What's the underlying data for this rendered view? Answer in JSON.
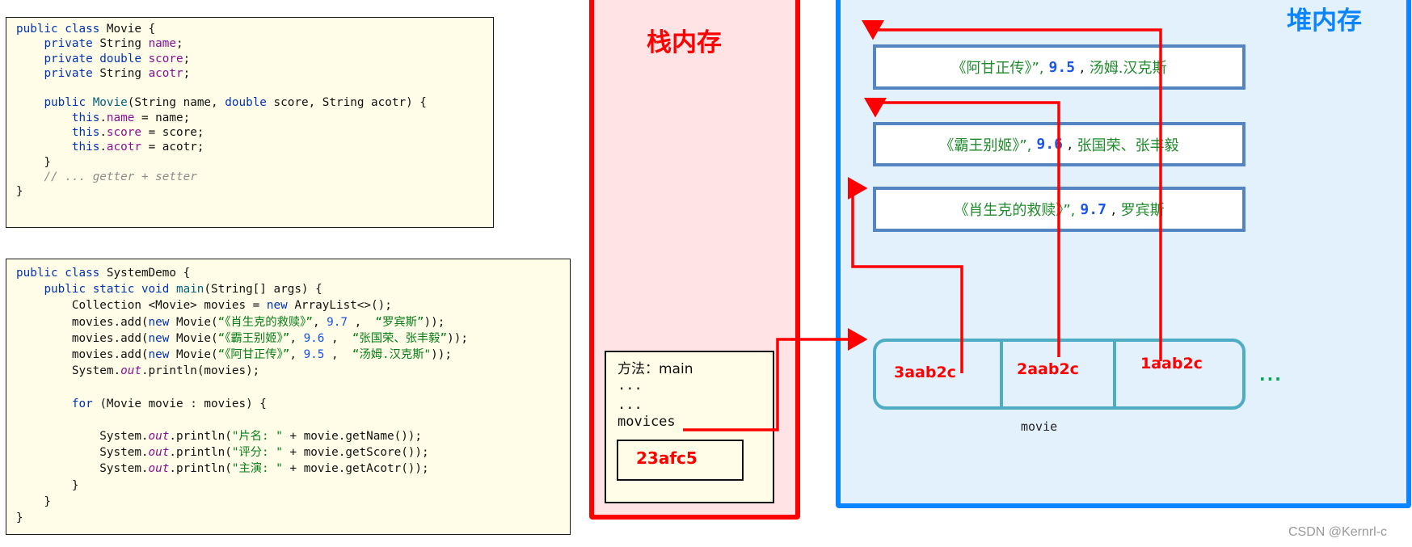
{
  "code_movie": {
    "lines": [
      [
        [
          "kw",
          "public class "
        ],
        [
          "",
          "Movie {"
        ]
      ],
      [
        [
          "",
          "    "
        ],
        [
          "kw",
          "private "
        ],
        [
          "",
          "String "
        ],
        [
          "fld",
          "name"
        ],
        [
          "",
          ";"
        ]
      ],
      [
        [
          "",
          "    "
        ],
        [
          "kw",
          "private double "
        ],
        [
          "fld",
          "score"
        ],
        [
          "",
          ";"
        ]
      ],
      [
        [
          "",
          "    "
        ],
        [
          "kw",
          "private "
        ],
        [
          "",
          "String "
        ],
        [
          "fld",
          "acotr"
        ],
        [
          "",
          ";"
        ]
      ],
      [
        [
          "",
          ""
        ]
      ],
      [
        [
          "",
          "    "
        ],
        [
          "kw",
          "public "
        ],
        [
          "fn",
          "Movie"
        ],
        [
          "",
          "(String name, "
        ],
        [
          "kw",
          "double "
        ],
        [
          "",
          "score, String acotr) {"
        ]
      ],
      [
        [
          "",
          "        "
        ],
        [
          "kw",
          "this"
        ],
        [
          "",
          "."
        ],
        [
          "fld",
          "name"
        ],
        [
          "",
          " = name;"
        ]
      ],
      [
        [
          "",
          "        "
        ],
        [
          "kw",
          "this"
        ],
        [
          "",
          "."
        ],
        [
          "fld",
          "score"
        ],
        [
          "",
          " = score;"
        ]
      ],
      [
        [
          "",
          "        "
        ],
        [
          "kw",
          "this"
        ],
        [
          "",
          "."
        ],
        [
          "fld",
          "acotr"
        ],
        [
          "",
          " = acotr;"
        ]
      ],
      [
        [
          "",
          "    }"
        ]
      ],
      [
        [
          "",
          "    "
        ],
        [
          "cmt",
          "// ... getter + setter"
        ]
      ],
      [
        [
          "",
          "}"
        ]
      ]
    ]
  },
  "code_demo": {
    "lines": [
      [
        [
          "kw",
          "public class "
        ],
        [
          "",
          "SystemDemo {"
        ]
      ],
      [
        [
          "",
          "    "
        ],
        [
          "kw",
          "public static void "
        ],
        [
          "fn",
          "main"
        ],
        [
          "",
          "(String[] args) {"
        ]
      ],
      [
        [
          "",
          "        Collection <Movie> movies = "
        ],
        [
          "kw",
          "new "
        ],
        [
          "",
          "ArrayList<>();"
        ]
      ],
      [
        [
          "",
          "        movies.add("
        ],
        [
          "kw",
          "new "
        ],
        [
          "",
          "Movie("
        ],
        [
          "str",
          "“《肖生克的救赎》”"
        ],
        [
          "",
          ", "
        ],
        [
          "num",
          "9.7"
        ],
        [
          "",
          " ,  "
        ],
        [
          "str",
          "“罗宾斯”"
        ],
        [
          "",
          "));"
        ]
      ],
      [
        [
          "",
          "        movies.add("
        ],
        [
          "kw",
          "new "
        ],
        [
          "",
          "Movie("
        ],
        [
          "str",
          "“《霸王别姬》”"
        ],
        [
          "",
          ", "
        ],
        [
          "num",
          "9.6"
        ],
        [
          "",
          " ,  "
        ],
        [
          "str",
          "“张国荣、张丰毅”"
        ],
        [
          "",
          "));"
        ]
      ],
      [
        [
          "",
          "        movies.add("
        ],
        [
          "kw",
          "new "
        ],
        [
          "",
          "Movie("
        ],
        [
          "str",
          "“《阿甘正传》”"
        ],
        [
          "",
          ", "
        ],
        [
          "num",
          "9.5"
        ],
        [
          "",
          " ,  "
        ],
        [
          "str",
          "“汤姆.汉克斯\""
        ],
        [
          "",
          "));"
        ]
      ],
      [
        [
          "",
          "        System."
        ],
        [
          "st",
          "out"
        ],
        [
          "",
          ".println(movies);"
        ]
      ],
      [
        [
          "",
          ""
        ]
      ],
      [
        [
          "",
          "        "
        ],
        [
          "kw",
          "for "
        ],
        [
          "",
          "(Movie movie : movies) {"
        ]
      ],
      [
        [
          "",
          ""
        ]
      ],
      [
        [
          "",
          "            System."
        ],
        [
          "st",
          "out"
        ],
        [
          "",
          ".println("
        ],
        [
          "str",
          "\"片名: \""
        ],
        [
          "",
          " + movie.getName());"
        ]
      ],
      [
        [
          "",
          "            System."
        ],
        [
          "st",
          "out"
        ],
        [
          "",
          ".println("
        ],
        [
          "str",
          "\"评分: \""
        ],
        [
          "",
          " + movie.getScore());"
        ]
      ],
      [
        [
          "",
          "            System."
        ],
        [
          "st",
          "out"
        ],
        [
          "",
          ".println("
        ],
        [
          "str",
          "\"主演: \""
        ],
        [
          "",
          " + movie.getAcotr());"
        ]
      ],
      [
        [
          "",
          "        }"
        ]
      ],
      [
        [
          "",
          "    }"
        ]
      ],
      [
        [
          "",
          "}"
        ]
      ]
    ]
  },
  "stack": {
    "title": "栈内存",
    "frame": {
      "method_label": "方法：main",
      "line2": "...",
      "line3": "...",
      "var_name": "movices",
      "address": "23afc5"
    }
  },
  "heap": {
    "title": "堆内存",
    "objects": [
      {
        "name": "《阿甘正传》”,",
        "score": "9.5",
        "sep": ",",
        "actor": "汤姆.汉克斯"
      },
      {
        "name": "《霸王别姬》”,",
        "score": "9.6",
        "sep": ",",
        "actor": "张国荣、张丰毅"
      },
      {
        "name": "《肖生克的救赎》”,",
        "score": "9.7",
        "sep": ",",
        "actor": "罗宾斯"
      }
    ],
    "collection": {
      "refs": [
        "3aab2c",
        "2aab2c",
        "1aab2c"
      ],
      "label": "movie",
      "more": "..."
    }
  },
  "colors": {
    "stack": "#ff0000",
    "heap": "#0a84ff",
    "arrow": "#ff0000"
  },
  "watermark": "CSDN @Kernrl-c"
}
